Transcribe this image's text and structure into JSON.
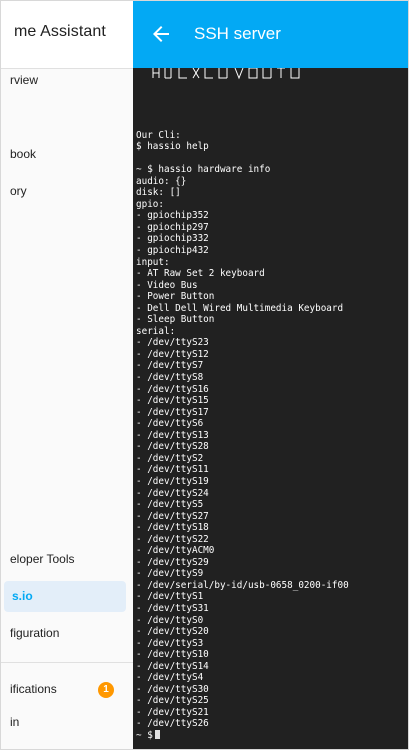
{
  "sidebar": {
    "app_title": "me Assistant",
    "items": [
      {
        "label": "rview"
      },
      {
        "label": "book"
      },
      {
        "label": "ory"
      },
      {
        "label": "eloper Tools"
      },
      {
        "label": "s.io",
        "active": true
      },
      {
        "label": "figuration"
      },
      {
        "label": "ifications",
        "badge": "1"
      },
      {
        "label": "in"
      }
    ]
  },
  "header": {
    "title": "SSH server",
    "back_icon": "arrow-left-icon"
  },
  "terminal": {
    "lines": [
      "",
      "Our Cli:",
      "$ hassio help",
      "",
      "~ $ hassio hardware info",
      "audio: {}",
      "disk: []",
      "gpio:",
      "- gpiochip352",
      "- gpiochip297",
      "- gpiochip332",
      "- gpiochip432",
      "input:",
      "- AT Raw Set 2 keyboard",
      "- Video Bus",
      "- Power Button",
      "- Dell Dell Wired Multimedia Keyboard",
      "- Sleep Button",
      "serial:",
      "- /dev/ttyS23",
      "- /dev/ttyS12",
      "- /dev/ttyS7",
      "- /dev/ttyS8",
      "- /dev/ttyS16",
      "- /dev/ttyS15",
      "- /dev/ttyS17",
      "- /dev/ttyS6",
      "- /dev/ttyS13",
      "- /dev/ttyS28",
      "- /dev/ttyS2",
      "- /dev/ttyS11",
      "- /dev/ttyS19",
      "- /dev/ttyS24",
      "- /dev/ttyS5",
      "- /dev/ttyS27",
      "- /dev/ttyS18",
      "- /dev/ttyS22",
      "- /dev/ttyACM0",
      "- /dev/ttyS29",
      "- /dev/ttyS9",
      "- /dev/serial/by-id/usb-0658_0200-if00",
      "- /dev/ttyS1",
      "- /dev/ttyS31",
      "- /dev/ttyS0",
      "- /dev/ttyS20",
      "- /dev/ttyS3",
      "- /dev/ttyS10",
      "- /dev/ttyS14",
      "- /dev/ttyS4",
      "- /dev/ttyS30",
      "- /dev/ttyS25",
      "- /dev/ttyS21",
      "- /dev/ttyS26"
    ],
    "prompt": "~ $"
  },
  "colors": {
    "accent": "#03a9f4",
    "terminal_bg": "#212121",
    "badge": "#ff9800"
  }
}
